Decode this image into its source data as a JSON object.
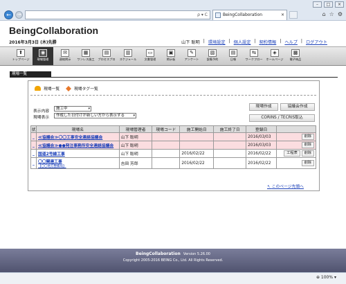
{
  "browser": {
    "address_icons": "ρ ▾ C",
    "tab_title": "BeingCollaboration",
    "zoom": "100%",
    "zoom_icon": "zoom-icon",
    "toolbar_icons": [
      "home-icon",
      "star-icon",
      "gear-icon"
    ]
  },
  "header": {
    "app_title": "BeingCollaboration",
    "date": "2016年3月3日 (木)先勝",
    "user": "山下  聡明",
    "links": [
      "環境設定",
      "個人設定",
      "契約情報",
      "ヘルプ",
      "ログアウト"
    ]
  },
  "menu": [
    {
      "label": "トップページ",
      "icon": "home-icon"
    },
    {
      "label": "現場管理",
      "icon": "site-icon",
      "active": true
    },
    {
      "label": "連絡掲示",
      "icon": "mail-icon"
    },
    {
      "label": "ワンレス施工",
      "icon": "grid-icon"
    },
    {
      "label": "プロセスプロ",
      "icon": "process-icon"
    },
    {
      "label": "スケジュール",
      "icon": "calendar-icon"
    },
    {
      "label": "文書管理",
      "icon": "folder-icon"
    },
    {
      "label": "掲示板",
      "icon": "board-icon"
    },
    {
      "label": "アンケート",
      "icon": "survey-icon"
    },
    {
      "label": "設備予約",
      "icon": "reserve-icon"
    },
    {
      "label": "日報",
      "icon": "report-icon"
    },
    {
      "label": "ワークフロー",
      "icon": "workflow-icon"
    },
    {
      "label": "ホームページ",
      "icon": "web-icon"
    },
    {
      "label": "電子納品",
      "icon": "delivery-icon"
    }
  ],
  "page": {
    "title": "現場一覧",
    "tabs": [
      "現場一覧",
      "現場タグ一覧"
    ],
    "filter_label": "表示内容",
    "filter_value": "施工中",
    "sort_label": "現場表示",
    "sort_value": "作成した日付けが新しい方から表示する",
    "buttons": {
      "create": "現場作成",
      "council": "協議会作成",
      "corins": "CORINS / TECRIS取込"
    },
    "back_to_top": "このページ先頭へ"
  },
  "table": {
    "headers": [
      "状",
      "現場名",
      "現場管理者",
      "現場コード",
      "施工開始日",
      "施工終了日",
      "登録日"
    ],
    "rows": [
      {
        "status": "_",
        "name": "≪協議会≫〇〇工事安全連絡協議会",
        "sub": "",
        "manager": "山下  聡明",
        "code": "",
        "start": "",
        "end": "",
        "registered": "2016/03/03",
        "actions": [
          "削除"
        ],
        "pink": true
      },
      {
        "status": "_",
        "name": "≪協議会≫●●発注事務所安全連絡協議会",
        "sub": "",
        "manager": "山下  聡明",
        "code": "",
        "start": "",
        "end": "",
        "registered": "2016/03/03",
        "actions": [
          "削除"
        ],
        "pink": true
      },
      {
        "status": "_",
        "name": "国道2号線工事",
        "sub": "",
        "manager": "山下  聡明",
        "code": "",
        "start": "2016/02/22",
        "end": "",
        "registered": "2016/02/22",
        "actions": [
          "工程表",
          "削除"
        ],
        "pink": false
      },
      {
        "status": "_",
        "name": "〇〇関連工事",
        "sub": "【〇〇地方整備局】",
        "manager": "吉田  芳郎",
        "code": "",
        "start": "2016/02/22",
        "end": "",
        "registered": "2016/02/22",
        "actions": [
          "削除"
        ],
        "pink": false
      }
    ]
  },
  "footer": {
    "app": "BeingCollaboration",
    "version": "Version 5.26.00",
    "copyright": "Copyright 2005-2016 BEING Co., Ltd. All Rights Reserved."
  }
}
